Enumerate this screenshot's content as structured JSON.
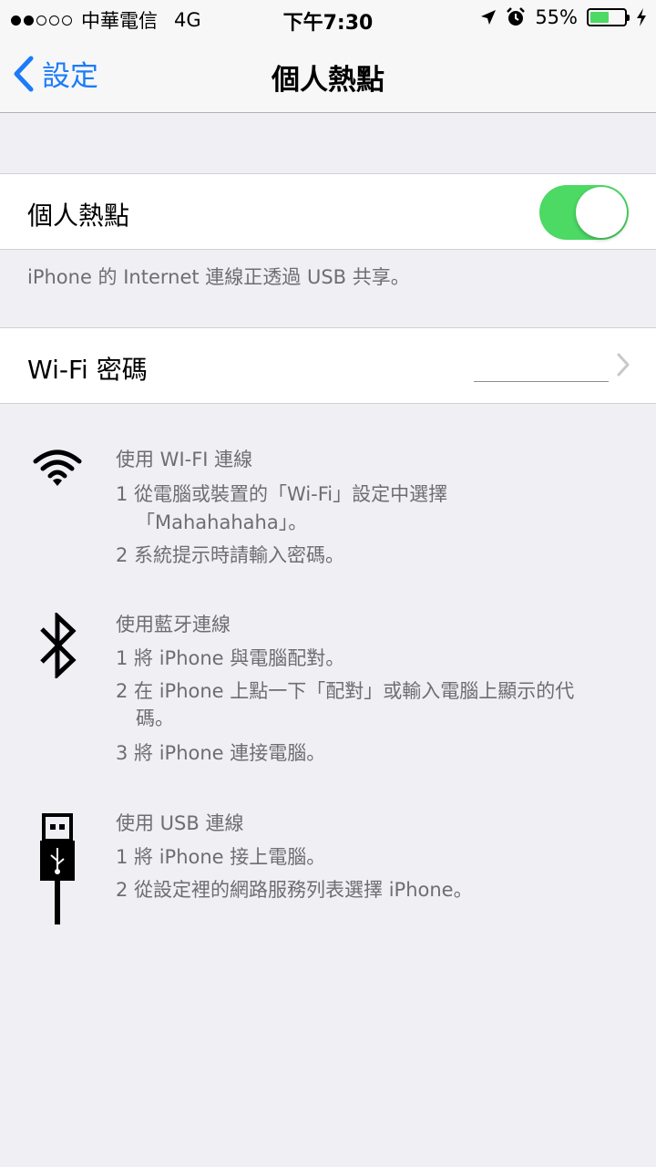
{
  "status_bar": {
    "carrier": "中華電信",
    "network": "4G",
    "time": "下午7:30",
    "battery": "55%",
    "battery_level": 0.55,
    "icons": [
      "location-arrow-icon",
      "alarm-icon",
      "charging-bolt-icon"
    ]
  },
  "nav": {
    "back_label": "設定",
    "title": "個人熱點"
  },
  "hotspot": {
    "label": "個人熱點",
    "enabled": true,
    "toggle_color": "#4cd964",
    "footer": "iPhone 的 Internet 連線正透過 USB 共享。"
  },
  "wifi_password": {
    "label": "Wi-Fi 密碼",
    "value": ""
  },
  "instructions": {
    "wifi": {
      "title": "使用 WI-FI 連線",
      "step1": "1 從電腦或裝置的「Wi-Fi」設定中選擇",
      "step1_cont": "「Mahahahaha」。",
      "step2": "2 系統提示時請輸入密碼。"
    },
    "bluetooth": {
      "title": "使用藍牙連線",
      "step1": "1 將 iPhone 與電腦配對。",
      "step2": "2 在 iPhone 上點一下「配對」或輸入電腦上顯示的代",
      "step2_cont": "碼。",
      "step3": "3 將 iPhone 連接電腦。"
    },
    "usb": {
      "title": "使用 USB 連線",
      "step1": "1 將 iPhone 接上電腦。",
      "step2": "2 從設定裡的網路服務列表選擇 iPhone。"
    }
  },
  "colors": {
    "accent": "#1b7cf6",
    "background": "#efeff4",
    "secondary_text": "#6d6d72"
  }
}
